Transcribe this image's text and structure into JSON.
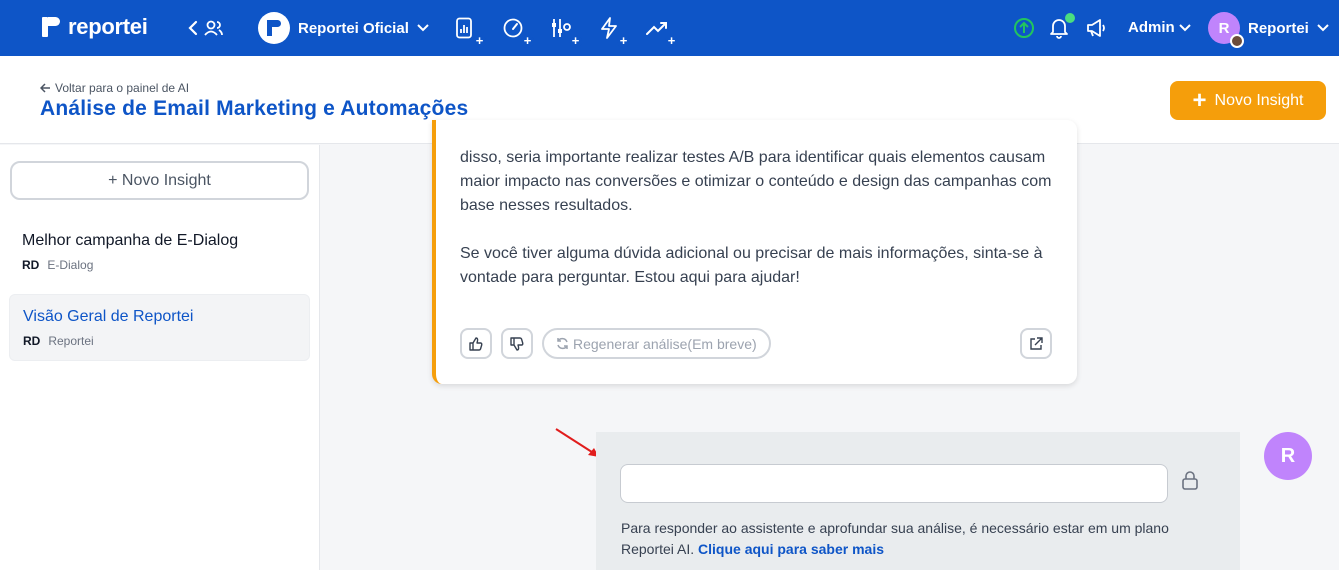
{
  "topbar": {
    "brand": "reportei",
    "account_name": "Reportei Oficial",
    "admin_label": "Admin",
    "user_initial": "R",
    "user_name": "Reportei"
  },
  "header": {
    "back_label": "Voltar para o painel de AI",
    "title": "Análise de Email Marketing e Automações",
    "new_insight_label": "Novo Insight"
  },
  "sidebar": {
    "new_insight_label": "+ Novo Insight",
    "items": [
      {
        "title": "Melhor campanha de E-Dialog",
        "badge": "RD",
        "source": "E-Dialog",
        "active": false
      },
      {
        "title": "Visão Geral de Reportei",
        "badge": "RD",
        "source": "Reportei",
        "active": true
      }
    ]
  },
  "message": {
    "paragraph_1": "disso, seria importante realizar testes A/B para identificar quais elementos causam maior impacto nas conversões e otimizar o conteúdo e design das campanhas com base nesses resultados.",
    "paragraph_2": "Se você tiver alguma dúvida adicional ou precisar de mais informações, sinta-se à vontade para perguntar. Estou aqui para ajudar!",
    "regenerate_label": "Regenerar análise(Em breve)"
  },
  "reply": {
    "input_value": "",
    "notice": "Para responder ao assistente e aprofundar sua análise, é necessário estar em um plano Reportei AI. ",
    "notice_link": "Clique aqui para saber mais",
    "avatar_initial": "R"
  },
  "colors": {
    "brand_blue": "#0e55c7",
    "accent_orange": "#f59e0b",
    "avatar_purple": "#c084fc",
    "success_green": "#22c55e"
  }
}
